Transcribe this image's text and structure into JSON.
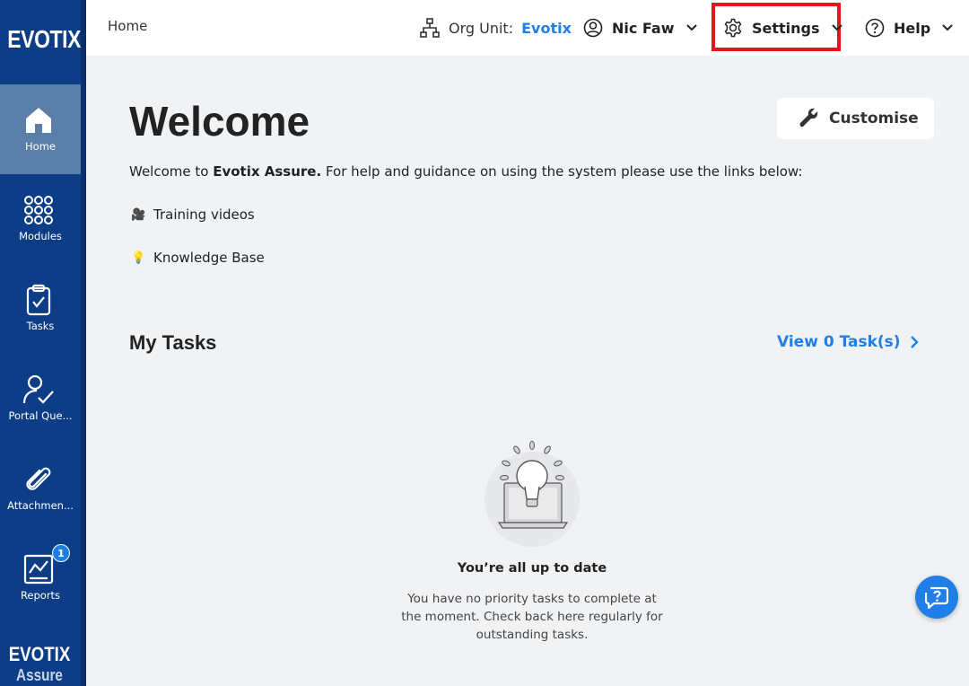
{
  "sidebar": {
    "brand": "EVOTIX",
    "items": [
      {
        "label": "Home"
      },
      {
        "label": "Modules"
      },
      {
        "label": "Tasks"
      },
      {
        "label": "Portal Que..."
      },
      {
        "label": "Attachmen..."
      },
      {
        "label": "Reports"
      }
    ],
    "reports_badge": "1",
    "footer_brand": "EVOTIX",
    "footer_product": "Assure"
  },
  "topbar": {
    "breadcrumb": "Home",
    "org_label": "Org Unit:",
    "org_value": "Evotix",
    "user_name": "Nic Faw",
    "settings_label": "Settings",
    "help_label": "Help"
  },
  "main": {
    "title": "Welcome",
    "customise_label": "Customise",
    "intro_prefix": "Welcome to ",
    "intro_product": "Evotix Assure.",
    "intro_suffix": " For help and guidance on using the system please use the links below:",
    "links": [
      {
        "emoji": "🎥",
        "label": "Training videos"
      },
      {
        "emoji": "💡",
        "label": "Knowledge Base"
      }
    ],
    "tasks_title": "My Tasks",
    "view_tasks_label": "View 0 Task(s)",
    "empty_title": "You’re all up to date",
    "empty_text": "You have no priority tasks to complete at the moment. Check back here regularly for outstanding tasks."
  },
  "colors": {
    "sidebar_bg": "#0d3d86",
    "active_item": "#5b7ea8",
    "accent": "#1f7fe6",
    "highlight_box": "#e8141c",
    "page_bg": "#f1f2f4"
  }
}
